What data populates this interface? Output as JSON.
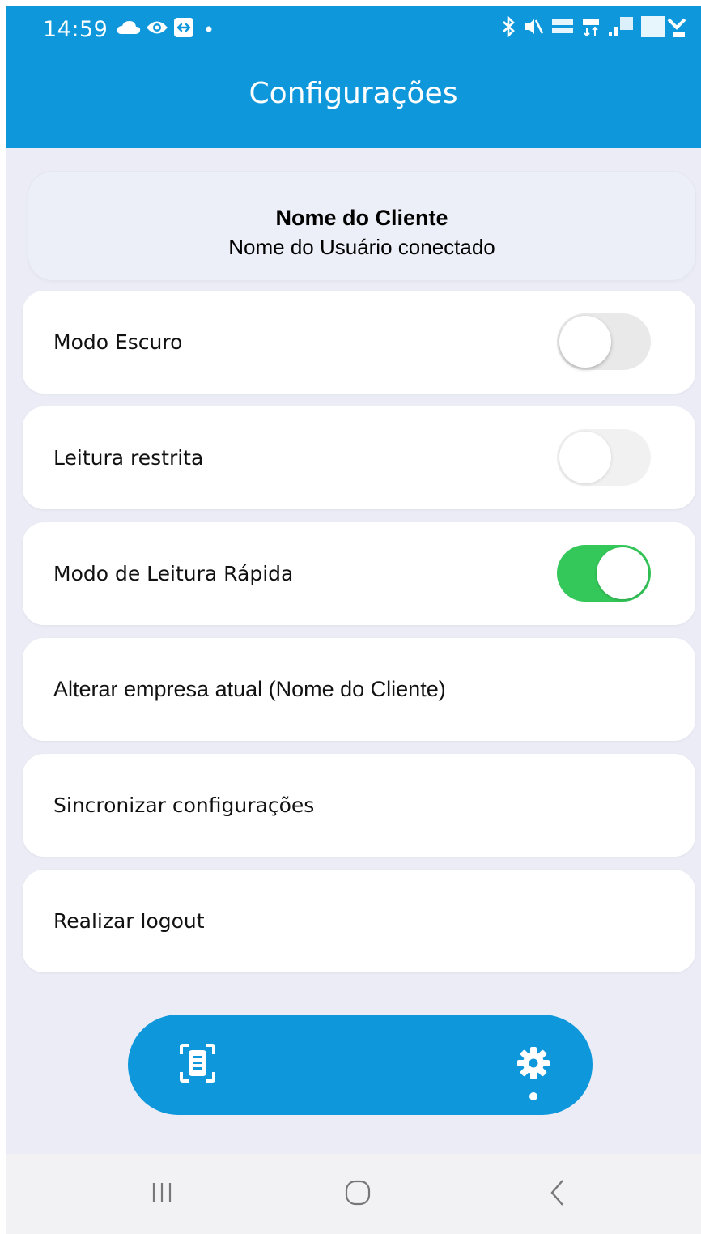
{
  "status_bar": {
    "time": "14:59",
    "left_icons": [
      "cloud-icon",
      "eye-icon",
      "screen-share-icon",
      "dot-icon"
    ],
    "right_icons": [
      "bluetooth-icon",
      "mute-icon",
      "volte-icon",
      "network-4g-icon",
      "signal-icon",
      "battery-icon"
    ]
  },
  "header": {
    "title": "Configurações"
  },
  "profile": {
    "client_name": "Nome do Cliente",
    "user_name": "Nome do Usuário conectado"
  },
  "settings": [
    {
      "label": "Modo Escuro",
      "toggle": "off"
    },
    {
      "label": "Leitura restrita",
      "toggle": "off-disabled"
    },
    {
      "label": "Modo de Leitura Rápida",
      "toggle": "on"
    },
    {
      "label": "Alterar empresa atual (Nome do Cliente)"
    },
    {
      "label": "Sincronizar configurações"
    },
    {
      "label": "Realizar logout"
    }
  ],
  "bottom_nav": {
    "items": [
      "scan-icon",
      "gear-icon"
    ],
    "active": "gear-icon"
  },
  "system_nav": [
    "recent-apps-icon",
    "home-icon",
    "back-icon"
  ],
  "colors": {
    "primary": "#0e98db",
    "background": "#ebecf6",
    "toggle_on": "#34c759",
    "toggle_off": "#e9e9ea"
  }
}
